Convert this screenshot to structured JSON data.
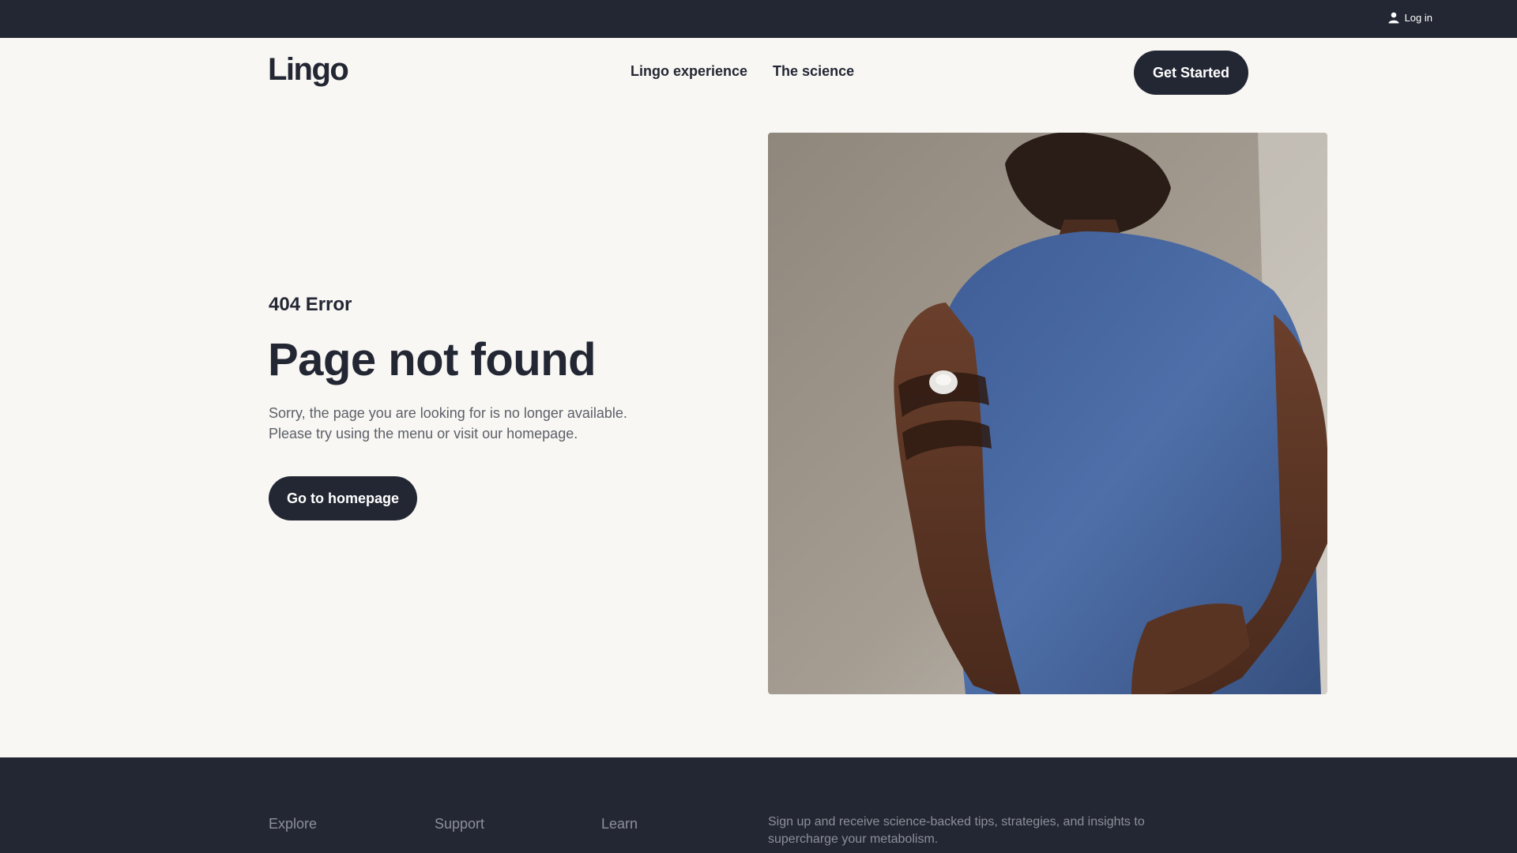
{
  "topbar": {
    "login_label": "Log in",
    "login_icon": "user-icon"
  },
  "header": {
    "logo": "Lingo",
    "nav": [
      {
        "label": "Lingo experience"
      },
      {
        "label": "The science"
      }
    ],
    "cta_label": "Get Started"
  },
  "main": {
    "error_label": "404 Error",
    "title": "Page not found",
    "description_line1": "Sorry, the page you are looking for is no longer available.",
    "description_line2": "Please try using the menu or visit our homepage.",
    "button_label": "Go to homepage"
  },
  "footer": {
    "columns": [
      {
        "title": "Explore"
      },
      {
        "title": "Support"
      },
      {
        "title": "Learn"
      }
    ],
    "newsletter_text": "Sign up and receive science-backed tips, strategies, and insights to supercharge your metabolism."
  },
  "colors": {
    "dark": "#232733",
    "background": "#f8f7f4",
    "muted_text": "#5d6068",
    "shirt_blue": "#4a6aa5"
  }
}
